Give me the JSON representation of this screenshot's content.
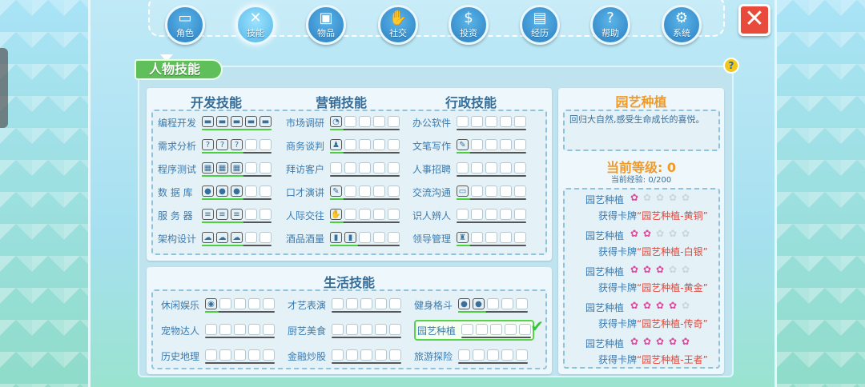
{
  "nav": {
    "items": [
      {
        "label": "角色",
        "icon": "id-card-icon",
        "glyph": "▭"
      },
      {
        "label": "技能",
        "icon": "tools-icon",
        "glyph": "✕"
      },
      {
        "label": "物品",
        "icon": "bag-icon",
        "glyph": "▣"
      },
      {
        "label": "社交",
        "icon": "handshake-icon",
        "glyph": "✋"
      },
      {
        "label": "投资",
        "icon": "coin-hand-icon",
        "glyph": "$"
      },
      {
        "label": "经历",
        "icon": "document-icon",
        "glyph": "▤"
      },
      {
        "label": "帮助",
        "icon": "question-icon",
        "glyph": "?"
      },
      {
        "label": "系统",
        "icon": "gear-icon",
        "glyph": "⚙"
      }
    ],
    "active": "技能"
  },
  "close": {
    "glyph": "✕"
  },
  "panel_title": "人物技能",
  "help": "?",
  "work": {
    "columns": [
      {
        "title": "开发技能",
        "skills": [
          {
            "name": "编程开发",
            "icon": "laptop-icon",
            "glyph": "▬",
            "filled": 5,
            "total": 5
          },
          {
            "name": "需求分析",
            "icon": "question-bubble-icon",
            "glyph": "?",
            "filled": 3,
            "total": 5
          },
          {
            "name": "程序测试",
            "icon": "computer-icon",
            "glyph": "▦",
            "filled": 3,
            "total": 5
          },
          {
            "name": "数 据 库",
            "icon": "database-icon",
            "glyph": "●",
            "filled": 3,
            "total": 5
          },
          {
            "name": "服 务 器",
            "icon": "server-icon",
            "glyph": "≡",
            "filled": 3,
            "total": 5
          },
          {
            "name": "架构设计",
            "icon": "cloud-icon",
            "glyph": "☁",
            "filled": 3,
            "total": 5
          }
        ]
      },
      {
        "title": "营销技能",
        "skills": [
          {
            "name": "市场调研",
            "icon": "pie-chart-icon",
            "glyph": "◔",
            "filled": 1,
            "total": 5
          },
          {
            "name": "商务谈判",
            "icon": "person-icon",
            "glyph": "♟",
            "filled": 1,
            "total": 5
          },
          {
            "name": "拜访客户",
            "icon": "people-icon",
            "glyph": "♙",
            "filled": 0,
            "total": 5
          },
          {
            "name": "口才演讲",
            "icon": "microphone-icon",
            "glyph": "✎",
            "filled": 1,
            "total": 5
          },
          {
            "name": "人际交往",
            "icon": "handshake-icon",
            "glyph": "✋",
            "filled": 1,
            "total": 5
          },
          {
            "name": "酒品酒量",
            "icon": "bottle-icon",
            "glyph": "▮",
            "filled": 2,
            "total": 5
          }
        ]
      },
      {
        "title": "行政技能",
        "skills": [
          {
            "name": "办公软件",
            "icon": "document-icon",
            "glyph": "▢",
            "filled": 0,
            "total": 5
          },
          {
            "name": "文笔写作",
            "icon": "note-icon",
            "glyph": "✎",
            "filled": 1,
            "total": 5
          },
          {
            "name": "人事招聘",
            "icon": "people-icon",
            "glyph": "♙",
            "filled": 0,
            "total": 5
          },
          {
            "name": "交流沟通",
            "icon": "chat-icon",
            "glyph": "▭",
            "filled": 1,
            "total": 5
          },
          {
            "name": "识人辨人",
            "icon": "eye-icon",
            "glyph": "◯",
            "filled": 0,
            "total": 5
          },
          {
            "name": "领导管理",
            "icon": "suit-icon",
            "glyph": "♜",
            "filled": 1,
            "total": 5
          }
        ]
      }
    ]
  },
  "life": {
    "title": "生活技能",
    "columns": [
      [
        {
          "name": "休闲娱乐",
          "icon": "gamepad-icon",
          "glyph": "◉",
          "filled": 1,
          "total": 5
        },
        {
          "name": "宠物达人",
          "icon": "pet-icon",
          "glyph": "▢",
          "filled": 0,
          "total": 5
        },
        {
          "name": "历史地理",
          "icon": "map-icon",
          "glyph": "▢",
          "filled": 0,
          "total": 5
        }
      ],
      [
        {
          "name": "才艺表演",
          "icon": "boot-icon",
          "glyph": "▙",
          "filled": 0,
          "total": 5
        },
        {
          "name": "厨艺美食",
          "icon": "chef-icon",
          "glyph": "▢",
          "filled": 0,
          "total": 5
        },
        {
          "name": "金融炒股",
          "icon": "money-bag-icon",
          "glyph": "◍",
          "filled": 0,
          "total": 5
        }
      ],
      [
        {
          "name": "健身格斗",
          "icon": "boxing-glove-icon",
          "glyph": "●",
          "filled": 2,
          "total": 5
        },
        {
          "name": "园艺种植",
          "icon": "flower-icon",
          "glyph": "✿",
          "filled": 0,
          "total": 5,
          "selected": true
        },
        {
          "name": "旅游探险",
          "icon": "mountain-icon",
          "glyph": "▲",
          "filled": 0,
          "total": 5
        }
      ]
    ],
    "check": "✔"
  },
  "detail": {
    "title": "园艺种植",
    "description": "回归大自然,感受生命成长的喜悦。",
    "level_label": "当前等级: 0",
    "exp_label": "当前经验: 0/200",
    "rewards": [
      {
        "name": "园艺种植",
        "flowers": 1,
        "get": "获得卡牌",
        "card": "“园艺种植-黄铜”"
      },
      {
        "name": "园艺种植",
        "flowers": 2,
        "get": "获得卡牌",
        "card": "“园艺种植-白银”"
      },
      {
        "name": "园艺种植",
        "flowers": 3,
        "get": "获得卡牌",
        "card": "“园艺种植-黄金”"
      },
      {
        "name": "园艺种植",
        "flowers": 4,
        "get": "获得卡牌",
        "card": "“园艺种植-传奇”"
      },
      {
        "name": "园艺种植",
        "flowers": 5,
        "get": "获得卡牌",
        "card": "“园艺种植-王者”"
      }
    ]
  },
  "colors": {
    "accent_orange": "#f09a28",
    "reward_red": "#e0483c",
    "label_blue": "#3a7bb1",
    "progress_green": "#4ccf3d",
    "close_red": "#e84a3c"
  }
}
